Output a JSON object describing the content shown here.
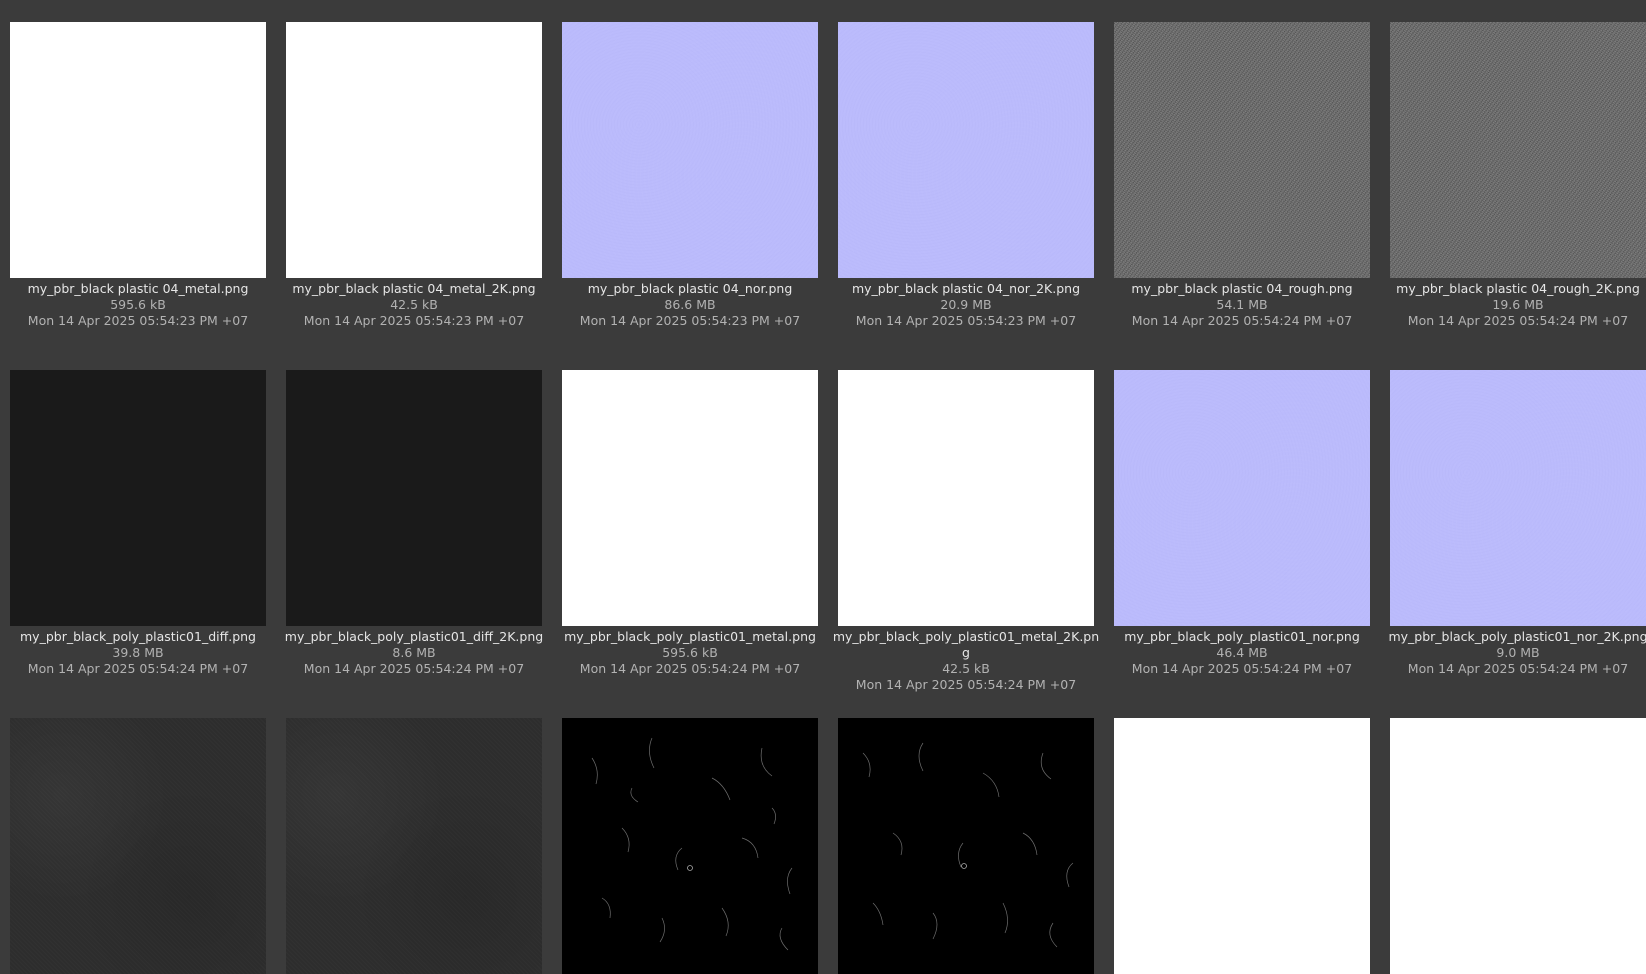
{
  "files": [
    {
      "name": "my_pbr_black plastic 04_metal.png",
      "size": "595.6 kB",
      "date": "Mon 14 Apr 2025 05:54:23 PM +07",
      "thumb": "white"
    },
    {
      "name": "my_pbr_black plastic 04_metal_2K.png",
      "size": "42.5 kB",
      "date": "Mon 14 Apr 2025 05:54:23 PM +07",
      "thumb": "white"
    },
    {
      "name": "my_pbr_black plastic 04_nor.png",
      "size": "86.6 MB",
      "date": "Mon 14 Apr 2025 05:54:23 PM +07",
      "thumb": "blue"
    },
    {
      "name": "my_pbr_black plastic 04_nor_2K.png",
      "size": "20.9 MB",
      "date": "Mon 14 Apr 2025 05:54:23 PM +07",
      "thumb": "blue"
    },
    {
      "name": "my_pbr_black plastic 04_rough.png",
      "size": "54.1 MB",
      "date": "Mon 14 Apr 2025 05:54:24 PM +07",
      "thumb": "noise"
    },
    {
      "name": "my_pbr_black plastic 04_rough_2K.png",
      "size": "19.6 MB",
      "date": "Mon 14 Apr 2025 05:54:24 PM +07",
      "thumb": "noise"
    },
    {
      "name": "my_pbr_black_poly_plastic01_diff.png",
      "size": "39.8 MB",
      "date": "Mon 14 Apr 2025 05:54:24 PM +07",
      "thumb": "black"
    },
    {
      "name": "my_pbr_black_poly_plastic01_diff_2K.png",
      "size": "8.6 MB",
      "date": "Mon 14 Apr 2025 05:54:24 PM +07",
      "thumb": "black"
    },
    {
      "name": "my_pbr_black_poly_plastic01_metal.png",
      "size": "595.6 kB",
      "date": "Mon 14 Apr 2025 05:54:24 PM +07",
      "thumb": "white"
    },
    {
      "name": "my_pbr_black_poly_plastic01_metal_2K.png",
      "size": "42.5 kB",
      "date": "Mon 14 Apr 2025 05:54:24 PM +07",
      "thumb": "white"
    },
    {
      "name": "my_pbr_black_poly_plastic01_nor.png",
      "size": "46.4 MB",
      "date": "Mon 14 Apr 2025 05:54:24 PM +07",
      "thumb": "blue"
    },
    {
      "name": "my_pbr_black_poly_plastic01_nor_2K.png",
      "size": "9.0 MB",
      "date": "Mon 14 Apr 2025 05:54:24 PM +07",
      "thumb": "blue"
    },
    {
      "thumb": "dark"
    },
    {
      "thumb": "dark"
    },
    {
      "thumb": "scratch"
    },
    {
      "thumb": "scratch"
    },
    {
      "thumb": "white"
    },
    {
      "thumb": "white"
    }
  ]
}
